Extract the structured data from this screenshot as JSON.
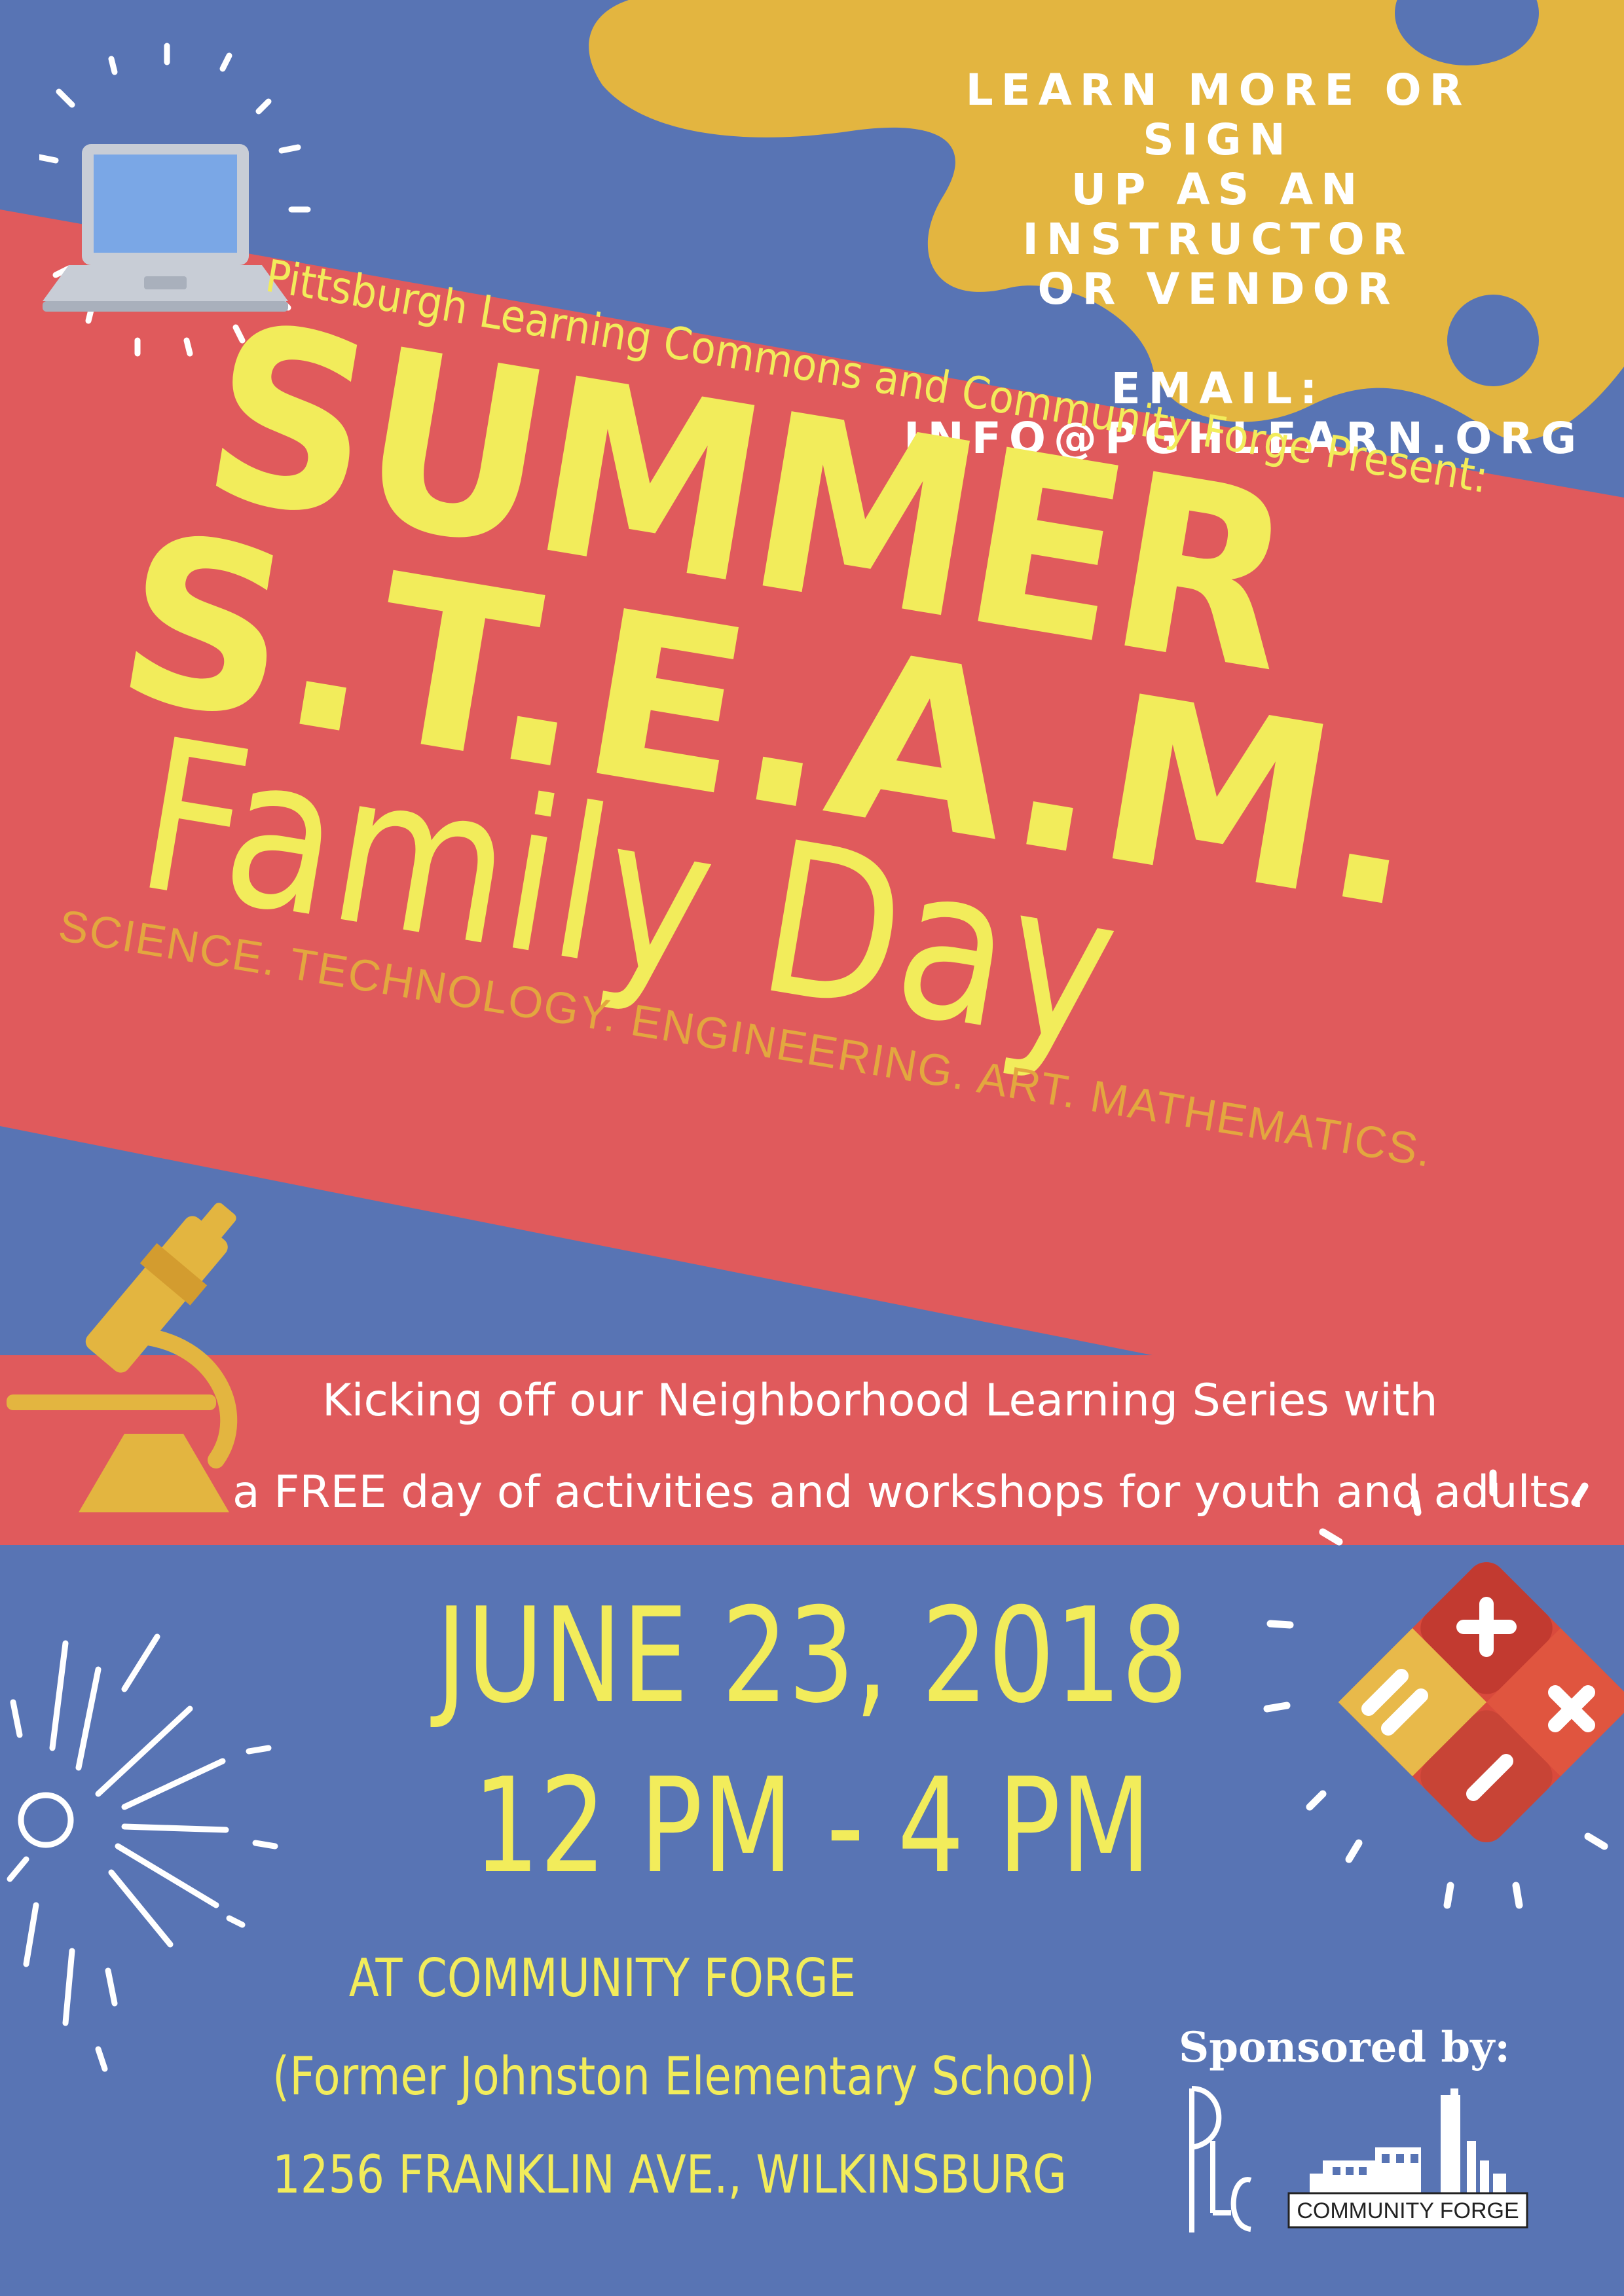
{
  "contact": {
    "line1": "LEARN MORE OR SIGN",
    "line2": "UP AS AN INSTRUCTOR",
    "line3": "OR VENDOR",
    "email_label": "EMAIL:",
    "email": "INFO@PGHLEARN.ORG"
  },
  "header": {
    "tagline": "Pittsburgh Learning Commons and Community Forge Present:",
    "title_line1": "SUMMER",
    "title_line2": "S.T.E.A.M.",
    "title_line3": "Family Day",
    "subtitle": "SCIENCE. TECHNOLOGY. ENGINEERING. ART. MATHEMATICS."
  },
  "description": {
    "line1": "Kicking off our Neighborhood Learning Series with",
    "line2": "a FREE day of activities and workshops for youth and adults."
  },
  "event": {
    "date": "JUNE 23, 2018",
    "time": "12 PM - 4 PM",
    "venue": "AT COMMUNITY FORGE",
    "venue_note": "(Former Johnston Elementary School)",
    "address": "1256 FRANKLIN AVE., WILKINSBURG"
  },
  "sponsors": {
    "label": "Sponsored by:",
    "logo1_text": "PLC",
    "logo2_text": "COMMUNITY FORGE"
  },
  "colors": {
    "background_blue": "#5874b4",
    "banner_red": "#e05a5c",
    "blob_gold": "#e3b540",
    "title_yellow": "#f2ec5b",
    "subtitle_orange": "#e3a73f",
    "text_white": "#ffffff"
  },
  "icons": [
    "laptop-icon",
    "microscope-icon",
    "calculator-icon",
    "sparkle-icon",
    "sunburst-icon"
  ]
}
